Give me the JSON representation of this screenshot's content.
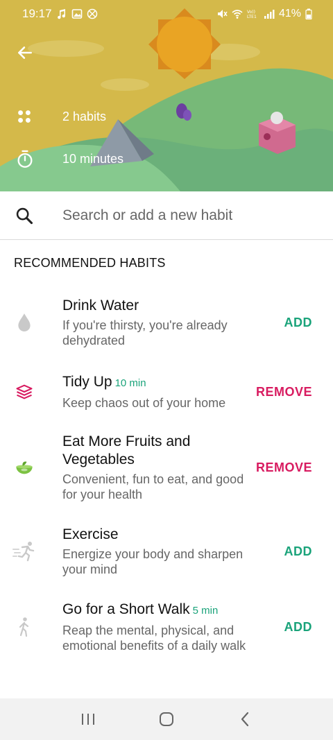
{
  "status_bar": {
    "time": "19:17",
    "battery": "41%"
  },
  "header": {
    "habits_count": "2 habits",
    "duration": "10 minutes"
  },
  "search": {
    "placeholder": "Search or add a new habit"
  },
  "section": {
    "title": "RECOMMENDED HABITS"
  },
  "habits": [
    {
      "title": "Drink Water",
      "duration": "",
      "description": "If you're thirsty, you're already dehydrated",
      "action": "ADD",
      "icon": "water-drop-icon"
    },
    {
      "title": "Tidy Up",
      "duration": "10 min",
      "description": "Keep chaos out of your home",
      "action": "REMOVE",
      "icon": "layers-icon"
    },
    {
      "title": "Eat More Fruits and Vegetables",
      "duration": "",
      "description": "Convenient, fun to eat, and good for your health",
      "action": "REMOVE",
      "icon": "salad-bowl-icon"
    },
    {
      "title": "Exercise",
      "duration": "",
      "description": "Energize your body and sharpen your mind",
      "action": "ADD",
      "icon": "runner-icon"
    },
    {
      "title": "Go for a Short Walk",
      "duration": "5 min",
      "description": "Reap the mental, physical, and emotional benefits of a daily walk",
      "action": "ADD",
      "icon": "walker-icon"
    }
  ],
  "colors": {
    "add": "#1aa37a",
    "remove": "#d81b60",
    "hero_sky": "#d4b94a",
    "hero_hill": "#6dbb7a"
  }
}
